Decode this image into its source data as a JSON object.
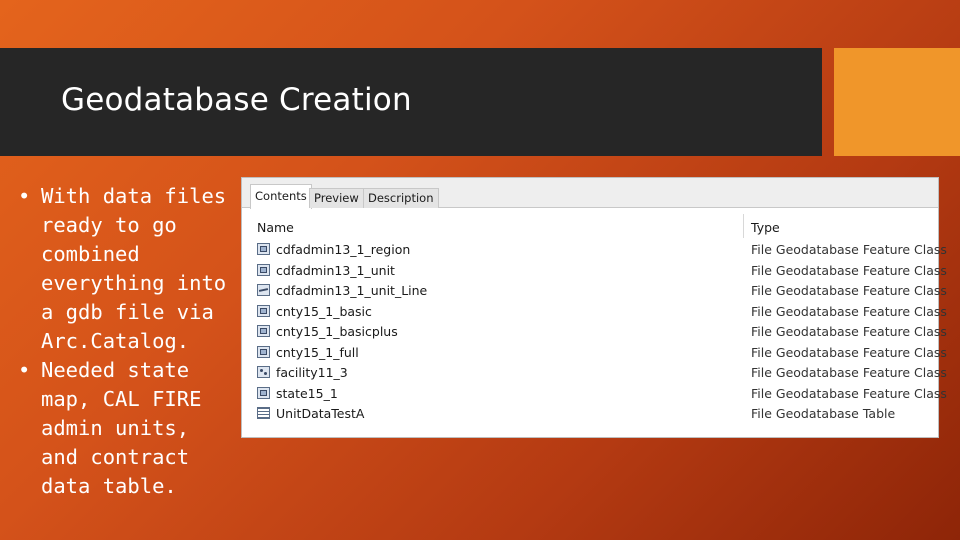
{
  "slide": {
    "title": "Geodatabase Creation",
    "bullets": [
      "With data files ready to go combined everything into a gdb file via Arc.Catalog.",
      "Needed state map, CAL FIRE admin units, and contract data table."
    ],
    "bullet_symbol": "•",
    "colors": {
      "title_bar": "#262626",
      "accent": "#f0962a",
      "background_start": "#e4641c",
      "background_end": "#8e2508"
    }
  },
  "catalog": {
    "tabs": [
      "Contents",
      "Preview",
      "Description"
    ],
    "active_tab": "Contents",
    "columns": {
      "name": "Name",
      "type": "Type"
    },
    "rows": [
      {
        "name": "cdfadmin13_1_region",
        "type": "File Geodatabase Feature Class",
        "icon": "polygon-feature-class-icon"
      },
      {
        "name": "cdfadmin13_1_unit",
        "type": "File Geodatabase Feature Class",
        "icon": "polygon-feature-class-icon"
      },
      {
        "name": "cdfadmin13_1_unit_Line",
        "type": "File Geodatabase Feature Class",
        "icon": "line-feature-class-icon"
      },
      {
        "name": "cnty15_1_basic",
        "type": "File Geodatabase Feature Class",
        "icon": "polygon-feature-class-icon"
      },
      {
        "name": "cnty15_1_basicplus",
        "type": "File Geodatabase Feature Class",
        "icon": "polygon-feature-class-icon"
      },
      {
        "name": "cnty15_1_full",
        "type": "File Geodatabase Feature Class",
        "icon": "polygon-feature-class-icon"
      },
      {
        "name": "facility11_3",
        "type": "File Geodatabase Feature Class",
        "icon": "point-feature-class-icon"
      },
      {
        "name": "state15_1",
        "type": "File Geodatabase Feature Class",
        "icon": "polygon-feature-class-icon"
      },
      {
        "name": "UnitDataTestA",
        "type": "File Geodatabase Table",
        "icon": "table-icon"
      }
    ]
  }
}
